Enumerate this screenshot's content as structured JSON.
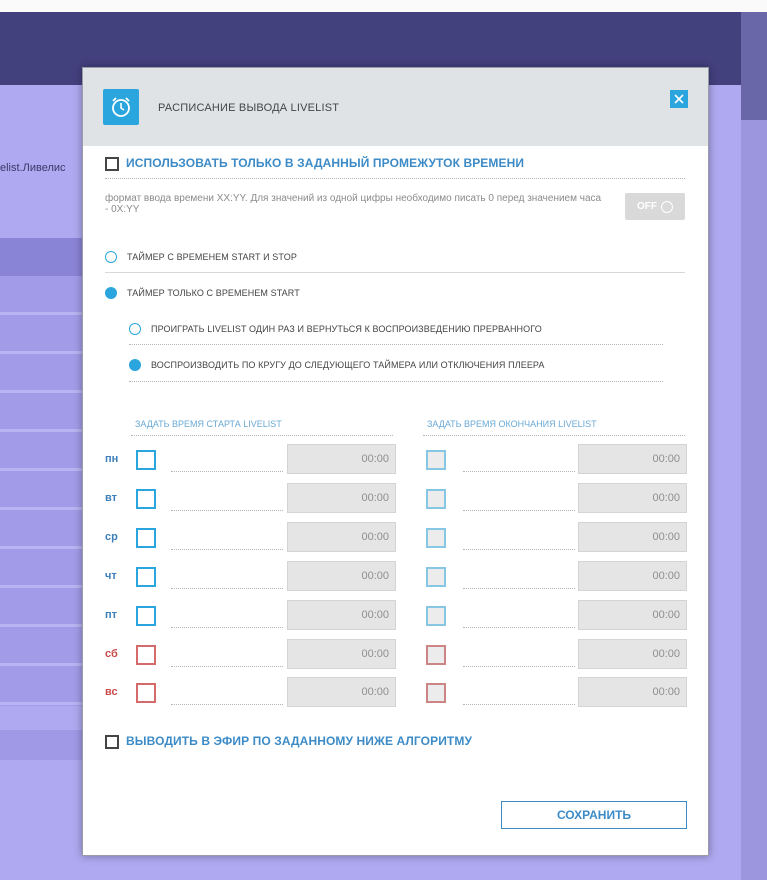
{
  "background": {
    "left_text": "elist.Ливелис"
  },
  "dialog": {
    "title": "РАСПИСАНИЕ ВЫВОДА LIVELIST",
    "icon": "alarm-clock-icon",
    "close_icon": "close-icon",
    "accent_color": "#2aa5de",
    "use_interval": {
      "label": "ИСПОЛЬЗОВАТЬ ТОЛЬКО В ЗАДАННЫЙ ПРОМЕЖУТОК ВРЕМЕНИ",
      "checked": false
    },
    "hint": "формат ввода времени XX:YY. Для значений из одной цифры необходимо писать 0 перед значением часа - 0X:YY",
    "toggle": {
      "label": "OFF",
      "state": "off"
    },
    "timer_options": [
      {
        "label": "ТАЙМЕР С ВРЕМЕНЕМ START И STOP",
        "selected": false
      },
      {
        "label": "ТАЙМЕР ТОЛЬКО С ВРЕМЕНЕМ START",
        "selected": true
      }
    ],
    "sub_options": [
      {
        "label": "ПРОИГРАТЬ LIVELIST ОДИН РАЗ И ВЕРНУТЬСЯ К ВОСПРОИЗВЕДЕНИЮ ПРЕРВАННОГО",
        "selected": false
      },
      {
        "label": "ВОСПРОИЗВОДИТЬ ПО КРУГУ ДО СЛЕДУЮЩЕГО ТАЙМЕРА ИЛИ ОТКЛЮЧЕНИЯ ПЛЕЕРА",
        "selected": true
      }
    ],
    "start_header": "ЗАДАТЬ ВРЕМЯ СТАРТА LIVELIST",
    "end_header": "ЗАДАТЬ ВРЕМЯ ОКОНЧАНИЯ LIVELIST",
    "days": [
      {
        "label": "пн",
        "start": "00:00",
        "end": "00:00",
        "weekend": false
      },
      {
        "label": "вт",
        "start": "00:00",
        "end": "00:00",
        "weekend": false
      },
      {
        "label": "ср",
        "start": "00:00",
        "end": "00:00",
        "weekend": false
      },
      {
        "label": "чт",
        "start": "00:00",
        "end": "00:00",
        "weekend": false
      },
      {
        "label": "пт",
        "start": "00:00",
        "end": "00:00",
        "weekend": false
      },
      {
        "label": "сб",
        "start": "00:00",
        "end": "00:00",
        "weekend": true
      },
      {
        "label": "вс",
        "start": "00:00",
        "end": "00:00",
        "weekend": true
      }
    ],
    "algorithm": {
      "label": "ВЫВОДИТЬ В ЭФИР ПО ЗАДАННОМУ НИЖЕ АЛГОРИТМУ",
      "checked": false
    },
    "save_label": "СОХРАНИТЬ"
  }
}
